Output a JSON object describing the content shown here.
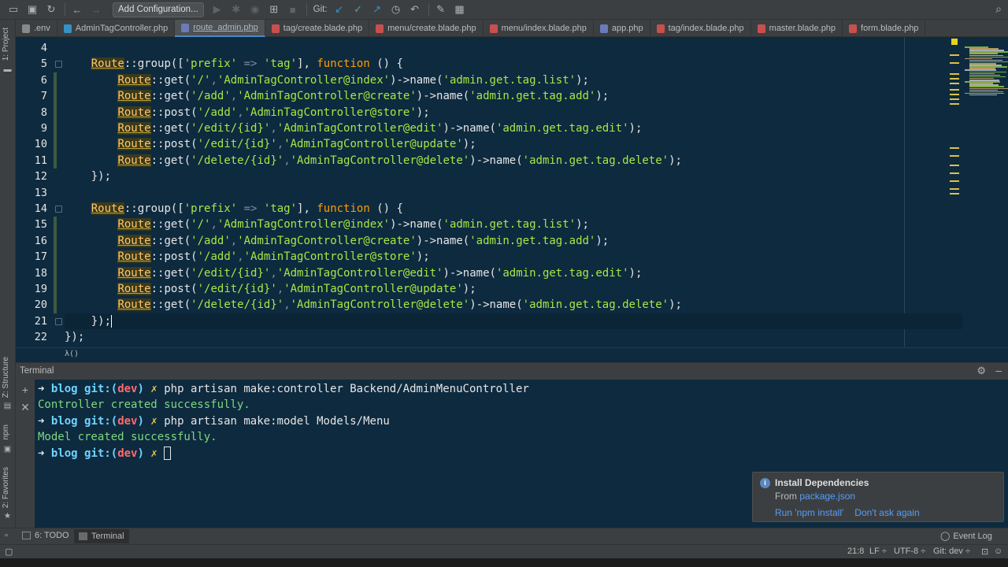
{
  "toolbar": {
    "config_label": "Add Configuration...",
    "git_label": "Git:"
  },
  "tabs": [
    {
      "label": ".env",
      "type": "env",
      "active": false
    },
    {
      "label": "AdminTagController.php",
      "type": "ctrl",
      "active": false
    },
    {
      "label": "route_admin.php",
      "type": "php",
      "active": true
    },
    {
      "label": "tag/create.blade.php",
      "type": "blade",
      "active": false
    },
    {
      "label": "menu/create.blade.php",
      "type": "blade",
      "active": false
    },
    {
      "label": "menu/index.blade.php",
      "type": "blade",
      "active": false
    },
    {
      "label": "app.php",
      "type": "php",
      "active": false
    },
    {
      "label": "tag/index.blade.php",
      "type": "blade",
      "active": false
    },
    {
      "label": "master.blade.php",
      "type": "blade",
      "active": false
    },
    {
      "label": "form.blade.php",
      "type": "blade",
      "active": false
    }
  ],
  "left_strip": {
    "project": "1: Project",
    "structure": "Z: Structure",
    "npm": "npm",
    "favorites": "2: Favorites"
  },
  "editor": {
    "line_numbers": [
      "4",
      "5",
      "6",
      "7",
      "8",
      "9",
      "10",
      "11",
      "12",
      "13",
      "14",
      "15",
      "16",
      "17",
      "18",
      "19",
      "20",
      "21",
      "22"
    ],
    "breadcrumb": "λ()",
    "tokens": {
      "route": "Route",
      "group_prefix": "::group([",
      "prefix_key": "'prefix'",
      "arrow_op": " => ",
      "tag_val": "'tag'",
      "function_kw": "function",
      "fn_close": " () {",
      "get": "::get(",
      "post": "::post(",
      "name_call": "->name(",
      "close_name": ");",
      "group_end": "});",
      "outer_end": "});"
    },
    "routes_block_1": [
      {
        "method": "get",
        "path": "'/'",
        "action": "'AdminTagController@index'",
        "name": "'admin.get.tag.list'"
      },
      {
        "method": "get",
        "path": "'/add'",
        "action": "'AdminTagController@create'",
        "name": "'admin.get.tag.add'"
      },
      {
        "method": "post",
        "path": "'/add'",
        "action": "'AdminTagController@store'",
        "name": ""
      },
      {
        "method": "get",
        "path": "'/edit/{id}'",
        "action": "'AdminTagController@edit'",
        "name": "'admin.get.tag.edit'"
      },
      {
        "method": "post",
        "path": "'/edit/{id}'",
        "action": "'AdminTagController@update'",
        "name": ""
      },
      {
        "method": "get",
        "path": "'/delete/{id}'",
        "action": "'AdminTagController@delete'",
        "name": "'admin.get.tag.delete'"
      }
    ]
  },
  "terminal": {
    "title": "Terminal",
    "prompt_arrow": "➜",
    "dir": "blog",
    "git_prefix": "git:(",
    "branch": "dev",
    "git_suffix": ")",
    "dirty": "✗",
    "commands": [
      {
        "cmd": "php artisan make:controller Backend/AdminMenuController",
        "output": "Controller created successfully."
      },
      {
        "cmd": "php artisan make:model Models/Menu",
        "output": "Model created successfully."
      }
    ]
  },
  "notification": {
    "title": "Install Dependencies",
    "from_prefix": "From ",
    "from_link": "package.json",
    "action_install": "Run 'npm install'",
    "action_dismiss": "Don't ask again"
  },
  "toolwindows": {
    "todo": "6: TODO",
    "terminal": "Terminal",
    "event_log": "Event Log"
  },
  "status": {
    "position": "21:8",
    "line_sep": "LF ÷",
    "encoding": "UTF-8 ÷",
    "git": "Git: dev ÷"
  },
  "colors": {
    "editor_bg": "#0e2a3f",
    "string": "#a5e844",
    "keyword": "#ff9d00",
    "function": "#ffc66d",
    "accent_link": "#589df6"
  }
}
